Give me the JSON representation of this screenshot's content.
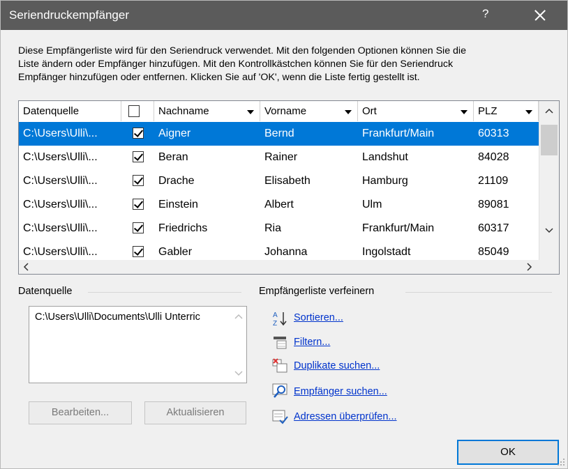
{
  "window": {
    "title": "Seriendruckempfänger",
    "help_label": "?",
    "close_label": "X"
  },
  "description": [
    "Diese Empfängerliste wird für den Seriendruck verwendet. Mit den folgenden Optionen können Sie die",
    "Liste ändern oder Empfänger hinzufügen. Mit den Kontrollkästchen können Sie für den Seriendruck",
    "Empfänger hinzufügen oder entfernen. Klicken Sie auf 'OK', wenn die Liste fertig gestellt ist."
  ],
  "table": {
    "columns": [
      "Datenquelle",
      "",
      "Nachname",
      "Vorname",
      "Ort",
      "PLZ"
    ],
    "rows": [
      {
        "source": "C:\\Users\\Ulli\\...",
        "checked": true,
        "last": "Aigner",
        "first": "Bernd",
        "city": "Frankfurt/Main",
        "zip": "60313",
        "selected": true
      },
      {
        "source": "C:\\Users\\Ulli\\...",
        "checked": true,
        "last": "Beran",
        "first": "Rainer",
        "city": "Landshut",
        "zip": "84028",
        "selected": false
      },
      {
        "source": "C:\\Users\\Ulli\\...",
        "checked": true,
        "last": "Drache",
        "first": "Elisabeth",
        "city": "Hamburg",
        "zip": "21109",
        "selected": false
      },
      {
        "source": "C:\\Users\\Ulli\\...",
        "checked": true,
        "last": "Einstein",
        "first": "Albert",
        "city": "Ulm",
        "zip": "89081",
        "selected": false
      },
      {
        "source": "C:\\Users\\Ulli\\...",
        "checked": true,
        "last": "Friedrichs",
        "first": "Ria",
        "city": "Frankfurt/Main",
        "zip": "60317",
        "selected": false
      },
      {
        "source": "C:\\Users\\Ulli\\...",
        "checked": true,
        "last": "Gabler",
        "first": "Johanna",
        "city": "Ingolstadt",
        "zip": "85049",
        "selected": false
      }
    ]
  },
  "datasource": {
    "heading": "Datenquelle",
    "path": "C:\\Users\\Ulli\\Documents\\Ulli Unterric",
    "edit_label": "Bearbeiten...",
    "refresh_label": "Aktualisieren"
  },
  "refine": {
    "heading": "Empfängerliste verfeinern",
    "links": [
      "Sortieren...",
      "Filtern...",
      "Duplikate suchen...",
      "Empfänger suchen...",
      "Adressen überprüfen..."
    ],
    "icons": [
      "sort-az-icon",
      "filter-icon",
      "duplicates-icon",
      "find-recipient-icon",
      "validate-addresses-icon"
    ]
  },
  "ok_label": "OK",
  "colors": {
    "titlebar": "#5b5b5b",
    "selection": "#0078d7",
    "link": "#0033cc"
  }
}
